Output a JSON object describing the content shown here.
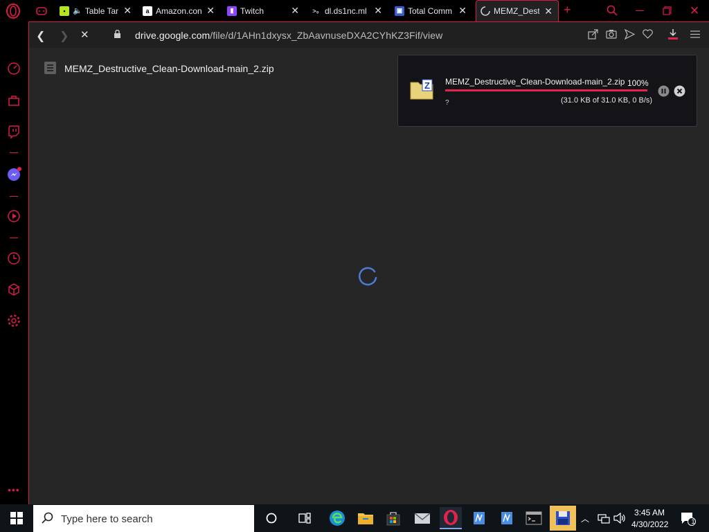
{
  "browser": {
    "tabs": [
      {
        "title": "Table Tan",
        "icon": "game-icon"
      },
      {
        "title": "Amazon.con",
        "icon": "amazon-icon"
      },
      {
        "title": "Twitch",
        "icon": "twitch-icon"
      },
      {
        "title": "dl.ds1nc.ml",
        "icon": "terminal-icon"
      },
      {
        "title": "Total Comma",
        "icon": "floppy-icon"
      },
      {
        "title": "MEMZ_Destr",
        "icon": "loading-spinner-icon"
      }
    ],
    "active_tab_index": 5,
    "accent_color": "#d81b48"
  },
  "toolbar": {
    "url_domain": "drive.google.com",
    "url_path": "/file/d/1AHn1dxysx_ZbAavnuseDXA2CYhKZ3Fif/view"
  },
  "page": {
    "file_name": "MEMZ_Destructive_Clean-Download-main_2.zip"
  },
  "download": {
    "file_name": "MEMZ_Destructive_Clean-Download-main_2.zip",
    "percent_text": "100%",
    "progress": 1.0,
    "status": "?",
    "size_text": "(31.0 KB of 31.0 KB, 0 B/s)"
  },
  "taskbar": {
    "search_placeholder": "Type here to search",
    "time": "3:45 AM",
    "date": "4/30/2022",
    "notification_count": "1"
  }
}
